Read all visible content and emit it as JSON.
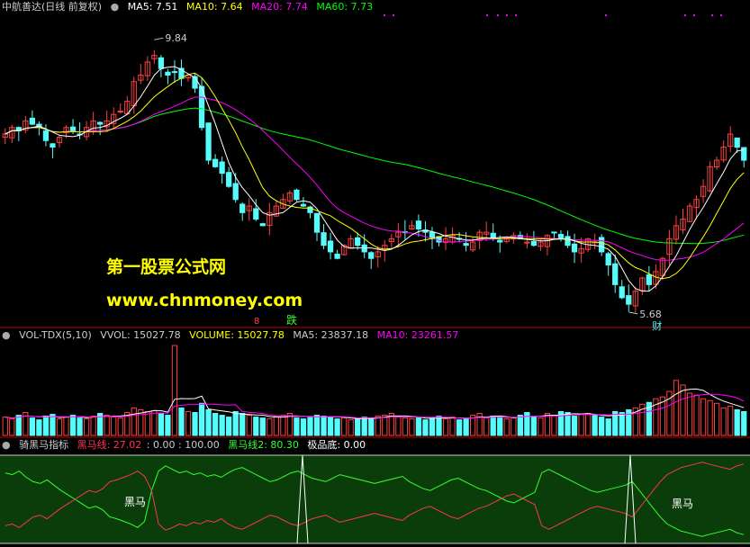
{
  "colors": {
    "bg": "#000000",
    "up": "#ff4040",
    "down": "#54fcfc",
    "ma5": "#ffffff",
    "ma10": "#ffff00",
    "ma20": "#ff00ff",
    "ma60": "#00ff00",
    "separator": "#c00000",
    "kdj_fill": "#0b3d0b",
    "kdj_green": "#33ff33",
    "kdj_red": "#ff3355",
    "watermark": "#ffff00"
  },
  "header": {
    "title": "中航善达(日线 前复权)",
    "ma5": "MA5: 7.51",
    "ma10": "MA10: 7.64",
    "ma20": "MA20: 7.74",
    "ma60": "MA60: 7.73"
  },
  "watermark": {
    "line1": "第一股票公式网",
    "line2": "www.chnmoney.com"
  },
  "price_panel": {
    "high_label": "9.84",
    "low_label": "5.68",
    "event_label_1": "跌",
    "event_label_2": "财",
    "event_marker": "8"
  },
  "volume_header": {
    "name": "VOL-TDX(5,10)",
    "vvol": "VVOL: 15027.78",
    "volume": "VOLUME: 15027.78",
    "ma5": "MA5: 23837.18",
    "ma10": "MA10: 23261.57"
  },
  "indicator_header": {
    "name": "骑黑马指标",
    "line1": "黑马线: 27.02",
    "line1_rest": ": 0.00 : 100.00",
    "line2": "黑马线2: 80.30",
    "line3": "极品底: 0.00"
  },
  "indicator_labels": {
    "horse_1": "黑马",
    "horse_2": "黑马"
  },
  "chart_data": {
    "type": "candlestick",
    "title": "中航善达(日线 前复权)",
    "price_range": [
      5.5,
      10.2
    ],
    "high": 9.84,
    "low": 5.68,
    "moving_averages": {
      "MA5": 7.51,
      "MA10": 7.64,
      "MA20": 7.74,
      "MA60": 7.73
    },
    "close_series": [
      8.4,
      8.5,
      8.45,
      8.6,
      8.55,
      8.5,
      8.3,
      8.2,
      8.35,
      8.5,
      8.45,
      8.4,
      8.5,
      8.6,
      8.55,
      8.6,
      8.7,
      8.75,
      8.9,
      9.2,
      9.3,
      9.5,
      9.6,
      9.4,
      9.3,
      9.35,
      9.25,
      9.3,
      9.1,
      8.5,
      8.0,
      7.9,
      7.8,
      7.6,
      7.4,
      7.2,
      7.3,
      7.1,
      7.0,
      7.2,
      7.3,
      7.4,
      7.5,
      7.4,
      7.3,
      7.2,
      6.9,
      6.7,
      6.6,
      6.5,
      6.7,
      6.8,
      6.7,
      6.6,
      6.5,
      6.6,
      6.7,
      6.8,
      6.9,
      6.9,
      7.0,
      6.95,
      6.9,
      6.8,
      6.75,
      6.8,
      6.85,
      6.8,
      6.7,
      6.75,
      6.9,
      6.9,
      6.8,
      6.75,
      6.8,
      6.85,
      6.8,
      6.75,
      6.7,
      6.75,
      6.85,
      6.9,
      6.8,
      6.7,
      6.6,
      6.65,
      6.8,
      6.75,
      6.6,
      6.4,
      6.1,
      5.9,
      5.8,
      6.0,
      6.2,
      6.1,
      6.3,
      6.5,
      6.8,
      7.0,
      7.1,
      7.3,
      7.4,
      7.6,
      7.9,
      8.0,
      8.2,
      8.4,
      8.2,
      8.0
    ],
    "volume_header": {
      "VVOL": 15027.78,
      "VOLUME": 15027.78,
      "MA5": 23837.18,
      "MA10": 23261.57
    },
    "volume_range": [
      0,
      120000
    ],
    "volume_series": [
      20,
      18,
      22,
      25,
      19,
      17,
      21,
      23,
      18,
      20,
      22,
      19,
      18,
      21,
      24,
      22,
      20,
      19,
      25,
      30,
      28,
      26,
      27,
      24,
      22,
      98,
      30,
      26,
      25,
      35,
      28,
      24,
      22,
      20,
      26,
      24,
      22,
      20,
      19,
      18,
      21,
      22,
      24,
      19,
      18,
      20,
      22,
      21,
      20,
      18,
      19,
      17,
      18,
      20,
      19,
      21,
      22,
      24,
      20,
      19,
      18,
      20,
      17,
      19,
      21,
      18,
      20,
      17,
      18,
      22,
      24,
      19,
      21,
      20,
      18,
      19,
      22,
      25,
      20,
      19,
      24,
      22,
      26,
      25,
      21,
      23,
      24,
      22,
      20,
      18,
      26,
      25,
      28,
      30,
      34,
      36,
      40,
      42,
      48,
      60,
      55,
      46,
      44,
      40,
      38,
      35,
      30,
      32,
      28,
      26
    ],
    "indicator": {
      "name": "骑黑马指标",
      "黑马线": 27.02,
      "黑马线2": 80.3,
      "极品底": 0.0,
      "range": [
        0,
        100
      ],
      "green_series": [
        80,
        78,
        82,
        75,
        70,
        68,
        72,
        66,
        60,
        55,
        50,
        45,
        40,
        42,
        38,
        30,
        28,
        25,
        22,
        18,
        25,
        60,
        82,
        88,
        84,
        80,
        82,
        78,
        80,
        76,
        78,
        75,
        80,
        84,
        86,
        82,
        78,
        74,
        70,
        72,
        76,
        80,
        82,
        78,
        74,
        72,
        70,
        74,
        78,
        76,
        74,
        72,
        70,
        68,
        70,
        72,
        74,
        76,
        70,
        66,
        62,
        60,
        64,
        68,
        72,
        74,
        70,
        66,
        62,
        60,
        56,
        52,
        48,
        46,
        50,
        54,
        58,
        80,
        84,
        80,
        76,
        72,
        68,
        64,
        60,
        58,
        60,
        62,
        64,
        66,
        70,
        60,
        50,
        40,
        30,
        22,
        18,
        14,
        12,
        10,
        8,
        10,
        12,
        14,
        16,
        12,
        10
      ],
      "red_series": [
        20,
        22,
        18,
        24,
        30,
        32,
        28,
        34,
        40,
        45,
        50,
        55,
        60,
        58,
        62,
        70,
        72,
        75,
        78,
        82,
        76,
        60,
        22,
        15,
        18,
        22,
        20,
        24,
        22,
        26,
        24,
        28,
        22,
        18,
        16,
        20,
        24,
        28,
        32,
        30,
        26,
        22,
        20,
        24,
        28,
        30,
        32,
        28,
        24,
        26,
        28,
        30,
        32,
        34,
        32,
        30,
        28,
        26,
        32,
        36,
        40,
        42,
        38,
        34,
        30,
        28,
        32,
        36,
        40,
        42,
        46,
        50,
        54,
        56,
        52,
        48,
        44,
        20,
        16,
        20,
        24,
        28,
        32,
        36,
        40,
        42,
        40,
        38,
        36,
        34,
        30,
        40,
        50,
        60,
        70,
        78,
        82,
        86,
        88,
        90,
        92,
        90,
        88,
        86,
        84,
        88,
        90
      ]
    }
  }
}
